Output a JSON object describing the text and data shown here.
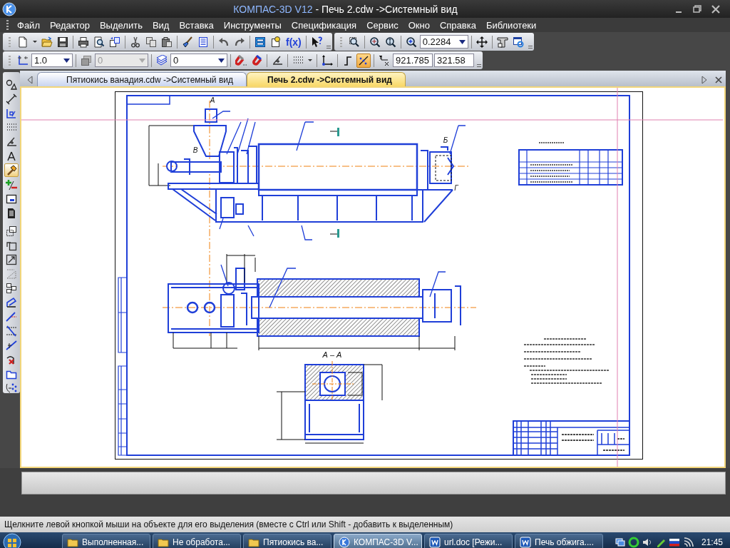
{
  "window": {
    "app_name": "КОМПАС-3D V12",
    "document_title": "- Печь 2.cdw ->Системный вид"
  },
  "menu": [
    "Файл",
    "Редактор",
    "Выделить",
    "Вид",
    "Вставка",
    "Инструменты",
    "Спецификация",
    "Сервис",
    "Окно",
    "Справка",
    "Библиотеки"
  ],
  "standard_toolbar": [
    {
      "kind": "new"
    },
    {
      "kind": "dropdown"
    },
    {
      "kind": "open"
    },
    {
      "kind": "save"
    },
    {
      "kind": "separator"
    },
    {
      "kind": "print"
    },
    {
      "kind": "preview"
    },
    {
      "kind": "properties"
    },
    {
      "kind": "separator"
    },
    {
      "kind": "cut"
    },
    {
      "kind": "copy"
    },
    {
      "kind": "paste"
    },
    {
      "kind": "separator"
    },
    {
      "kind": "brush"
    },
    {
      "kind": "list"
    },
    {
      "kind": "separator"
    },
    {
      "kind": "undo"
    },
    {
      "kind": "redo"
    },
    {
      "kind": "separator"
    },
    {
      "kind": "manager"
    },
    {
      "kind": "library"
    },
    {
      "kind": "variables",
      "label": "f(x)"
    },
    {
      "kind": "separator"
    },
    {
      "kind": "help"
    }
  ],
  "view_toolbar": [
    {
      "kind": "zoom-window"
    },
    {
      "kind": "separator"
    },
    {
      "kind": "zoom-in"
    },
    {
      "kind": "zoom-fit"
    },
    {
      "kind": "separator"
    },
    {
      "kind": "zoom-scale"
    },
    {
      "kind": "field",
      "value": "0.2284",
      "dropdown": true,
      "disabled": false
    },
    {
      "kind": "separator"
    },
    {
      "kind": "pan"
    },
    {
      "kind": "separator"
    },
    {
      "kind": "tree"
    },
    {
      "kind": "refresh"
    }
  ],
  "current_state_toolbar": [
    {
      "kind": "line-scale",
      "pressed": false
    },
    {
      "kind": "field",
      "value": "1.0",
      "dropdown": true,
      "disabled": false
    },
    {
      "kind": "separator"
    },
    {
      "kind": "view",
      "pressed": false
    },
    {
      "kind": "field",
      "value": "0",
      "dropdown": true,
      "disabled": true
    },
    {
      "kind": "separator"
    },
    {
      "kind": "layers",
      "pressed": false
    },
    {
      "kind": "field",
      "value": "0",
      "dropdown": true,
      "disabled": false
    },
    {
      "kind": "separator"
    },
    {
      "kind": "magnet",
      "pressed": false
    },
    {
      "kind": "magnet-off",
      "pressed": false
    },
    {
      "kind": "separator"
    },
    {
      "kind": "angle",
      "pressed": false
    },
    {
      "kind": "separator"
    },
    {
      "kind": "grid",
      "pressed": false
    },
    {
      "kind": "dropdown",
      "pressed": false
    },
    {
      "kind": "separator"
    },
    {
      "kind": "axes",
      "pressed": false
    },
    {
      "kind": "separator"
    },
    {
      "kind": "ortho",
      "pressed": false
    },
    {
      "kind": "snap",
      "pressed": true
    },
    {
      "kind": "separator"
    },
    {
      "kind": "coords",
      "pressed": false
    },
    {
      "kind": "field",
      "value": "921.785",
      "dropdown": false,
      "disabled": false
    },
    {
      "kind": "field",
      "value": "321.58",
      "dropdown": false,
      "disabled": false
    }
  ],
  "compact_toolbar": [
    {
      "kind": "geometry",
      "selected": false
    },
    {
      "kind": "dimension",
      "selected": false
    },
    {
      "kind": "symbols",
      "selected": false
    },
    {
      "kind": "grid",
      "selected": false
    },
    {
      "kind": "angle",
      "selected": false
    },
    {
      "kind": "compass",
      "selected": false
    },
    {
      "kind": "hammer",
      "selected": true
    },
    {
      "kind": "plus-minus",
      "selected": false
    },
    {
      "kind": "form",
      "selected": false
    },
    {
      "kind": "sheet",
      "selected": false
    },
    {
      "kind": "separator"
    },
    {
      "kind": "shift",
      "selected": false
    },
    {
      "kind": "rotate",
      "selected": false
    },
    {
      "kind": "scale",
      "selected": false
    },
    {
      "kind": "mirror",
      "selected": false
    },
    {
      "kind": "copy-group",
      "selected": false
    },
    {
      "kind": "deform",
      "selected": false
    },
    {
      "kind": "trim",
      "selected": false
    },
    {
      "kind": "trim-lines",
      "selected": false
    },
    {
      "kind": "break",
      "selected": false
    },
    {
      "kind": "delete",
      "selected": false
    },
    {
      "kind": "folder",
      "selected": false
    },
    {
      "kind": "array",
      "selected": false
    }
  ],
  "tabs": [
    {
      "label": "Пятиокись ванадия.cdw ->Системный вид",
      "selected": false
    },
    {
      "label": "Печь 2.cdw ->Системный вид",
      "selected": true
    }
  ],
  "drawing": {
    "labels": [
      "А",
      "Б",
      "В",
      "Г",
      "А – А"
    ]
  },
  "status_bar": "Щелкните левой кнопкой мыши на объекте для его выделения (вместе с Ctrl или Shift - добавить к выделенным)",
  "taskbar": {
    "items": [
      {
        "kind": "folder",
        "label": "Выполненная...",
        "selected": false
      },
      {
        "kind": "folder",
        "label": "Не обработа...",
        "selected": false
      },
      {
        "kind": "folder",
        "label": "Пятиокись ва...",
        "selected": false
      },
      {
        "kind": "kompas",
        "label": "КОМПАС-3D V...",
        "selected": true
      },
      {
        "kind": "word",
        "label": "url.doc [Режи...",
        "selected": false
      },
      {
        "kind": "word",
        "label": "Печь обжига....",
        "selected": false
      }
    ],
    "clock": "21:45"
  }
}
